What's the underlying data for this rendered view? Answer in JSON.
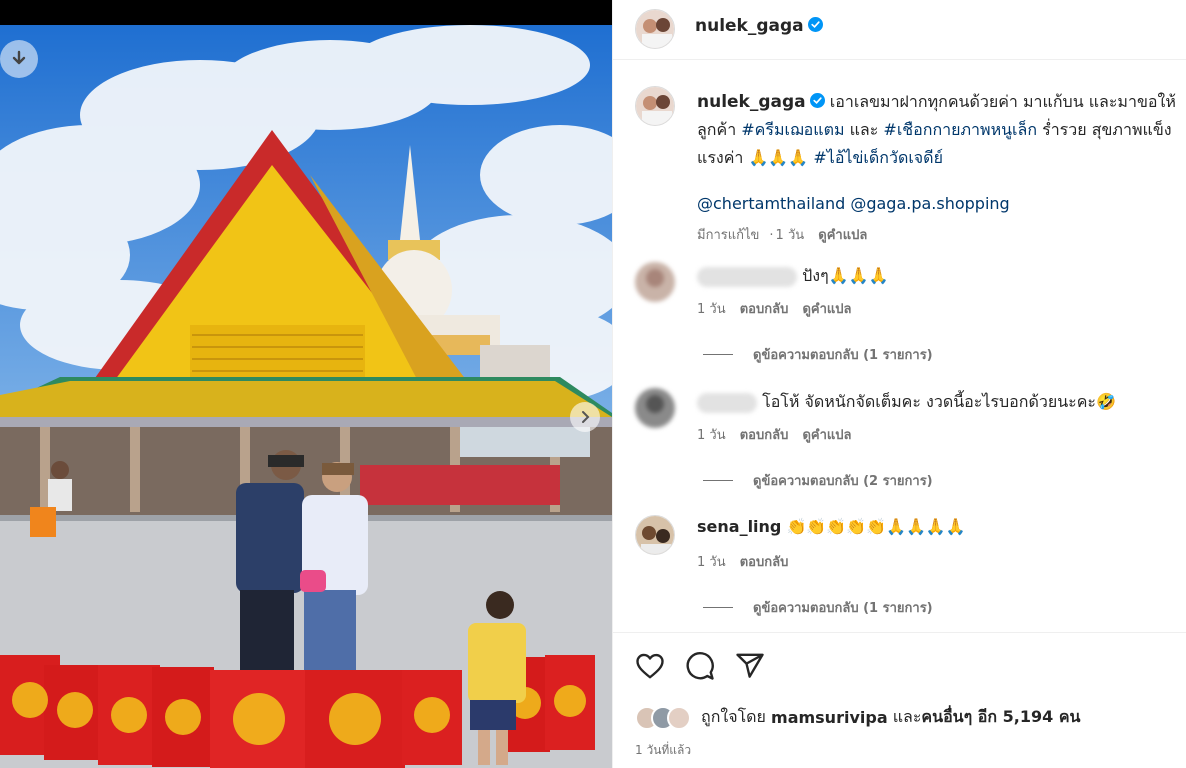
{
  "post": {
    "username": "nulek_gaga",
    "verified": true,
    "caption": {
      "text1": "เอาเลขมาฝากทุกคนด้วยค่า มาแก้บน และมาขอให้ลูกค้า ",
      "hashtag1": "#ครีมเฌอแตม",
      "text2": " และ ",
      "hashtag2": "#เชือกกายภาพหนูเล็ก",
      "text3": " ร่ำรวย สุขภาพแข็งแรงค่า ",
      "emojis": "🙏🙏🙏",
      "hashtag3": "#ไอ้ไข่เด็กวัดเจดีย์",
      "mention1": "@chertamthailand",
      "mention2": "@gaga.pa.shopping"
    },
    "caption_meta": {
      "edited": "มีการแก้ไข",
      "time": "1 วัน",
      "translate": "ดูคำแปล"
    }
  },
  "comments": [
    {
      "username_hidden": true,
      "text": "ปังๆ",
      "emojis": "🙏🙏🙏",
      "time": "1 วัน",
      "reply_label": "ตอบกลับ",
      "translate": "ดูคำแปล",
      "replies_label": "ดูข้อความตอบกลับ (1 รายการ)"
    },
    {
      "username_hidden": true,
      "text": "โอโห้ จัดหนักจัดเต็มคะ งวดนี้อะไรบอกด้วยนะคะ",
      "emojis": "🤣",
      "time": "1 วัน",
      "reply_label": "ตอบกลับ",
      "translate": "ดูคำแปล",
      "replies_label": "ดูข้อความตอบกลับ (2 รายการ)"
    },
    {
      "username": "sena_ling",
      "emojis": "👏👏👏👏👏🙏🙏🙏🙏",
      "time": "1 วัน",
      "reply_label": "ตอบกลับ",
      "replies_label": "ดูข้อความตอบกลับ (1 รายการ)"
    }
  ],
  "likes": {
    "prefix": "ถูกใจโดย",
    "user": "mamsurivipa",
    "middle": "และ",
    "others": "คนอื่นๆ อีก 5,194 คน"
  },
  "time_ago": "1 วันที่แล้ว",
  "icons": {
    "download": "download-icon",
    "next": "chevron-right-icon",
    "like": "heart-icon",
    "comment": "comment-icon",
    "share": "share-icon",
    "verified": "verified-badge-icon"
  },
  "colors": {
    "link": "#00376b",
    "verified": "#0095f6",
    "meta": "#737373",
    "text": "#262626"
  }
}
